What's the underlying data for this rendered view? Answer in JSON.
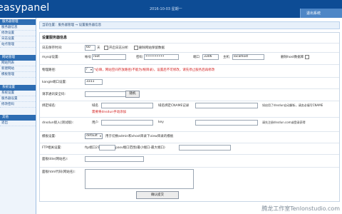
{
  "header": {
    "logo": "easypanel",
    "date": "2016-10-03 星期一",
    "right_link": "退出系统"
  },
  "sidebar": {
    "sections": [
      {
        "title": "服务器管理",
        "items": [
          "服务器信息",
          "修改设置",
          "日志设置",
          "站点管理"
        ]
      },
      {
        "title": "网站管理",
        "items": [
          "网站列表",
          "新建网站",
          "模板管理"
        ]
      },
      {
        "title": "系统设置",
        "items": [
          "系统设置",
          "服务器设置",
          "修改密码"
        ]
      },
      {
        "title": "其他",
        "items": [
          "退出"
        ]
      }
    ]
  },
  "breadcrumb": "当前位置：服务器管理 → 设置服务器信息",
  "form": {
    "title": "设置服务器信息",
    "log_days_label": "日志保存时间:",
    "log_days_value": "60",
    "log_days_unit": "天",
    "log_analysis_label": "开启日志分析",
    "delete_log_label": "删除网站保留数据",
    "mysql_label": "mysql设置:",
    "mysql_account_label": "帐号",
    "mysql_account_value": "root",
    "mysql_password_label": "密码",
    "mysql_password_value": "••••••••••",
    "mysql_port_label": "端口",
    "mysql_port_value": "3306",
    "mysql_host_label": "主机",
    "mysql_host_value": "localhost",
    "mysql_delete_label": "删除host数据库",
    "php_label": "物理路径:",
    "php_value": "/",
    "php_note": "*必填，网站空间存放路径(不能为/根目录)，设置后不可修改，请先停止服务后再修改",
    "kangle_port_label": "kangle端口设置:",
    "kangle_port_value": "3311",
    "security_code_label": "请求通讯安全码:",
    "security_code_button": "随机",
    "bind_domain_label": "绑定域名:",
    "bind_domain_field1_label": "域名",
    "bind_domain_field2_label": "域名绑定CNAME记录",
    "bind_domain_note": "如启用了dnsdun自动解析，请务必填写CNAME",
    "bind_domain_note2": "需要将dnsdun手动添加",
    "dnsdun_label": "dnsdun接入(测试版):",
    "dnsdun_user_label": "用户",
    "dnsdun_key_label": "key",
    "dnsdun_register_hint": "请先注册dnsdun.com或登录获得",
    "template_label": "模板设置:",
    "template_value": "default",
    "template_note": "用于切换admin和vhost目录下view目录的模板",
    "ftp_label": "FTP相关设置:",
    "ftp_port_label": "ftp端口21",
    "ftp_passive_label": "pasv端口范围(最小端口-最大端口)",
    "vhost_title_label": "面板title(网站名):",
    "vhost_code_label": "面板html代码(网站名):",
    "submit_button": "确认提交"
  },
  "watermark": "腾龙工作室Tenlonstudio.com"
}
